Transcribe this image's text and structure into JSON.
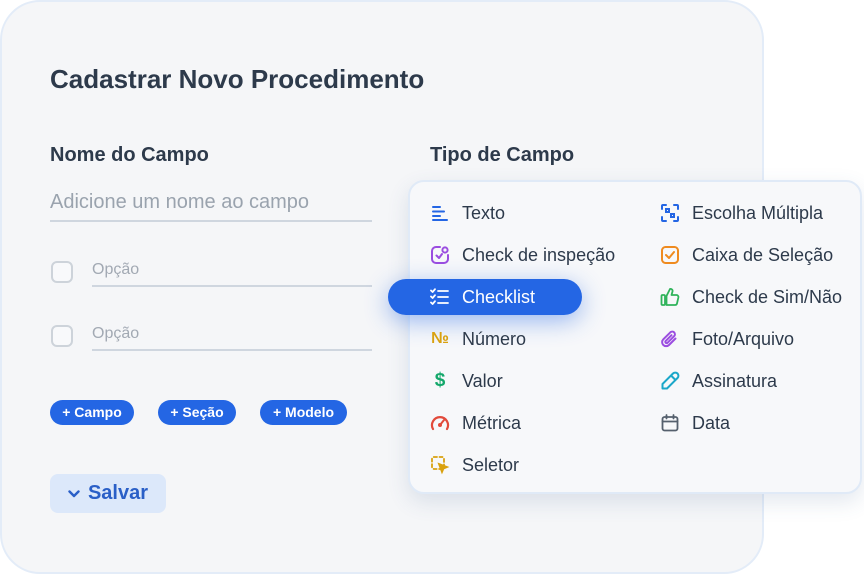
{
  "form": {
    "title": "Cadastrar Novo Procedimento",
    "field_name_label": "Nome do Campo",
    "field_name_placeholder": "Adicione um nome ao campo",
    "field_type_label": "Tipo de Campo",
    "options": [
      {
        "placeholder": "Opção",
        "checked": false
      },
      {
        "placeholder": "Opção",
        "checked": false
      }
    ],
    "add_buttons": [
      "+ Campo",
      "+ Seção",
      "+ Modelo"
    ],
    "save_label": "Salvar"
  },
  "field_types": {
    "selected": "Checklist",
    "left_column": [
      {
        "label": "Texto",
        "icon": "text-lines-icon",
        "color": "#2466e4"
      },
      {
        "label": "Check de inspeção",
        "icon": "check-inspection-icon",
        "color": "#9b4de0"
      },
      {
        "label": "Checklist",
        "icon": "checklist-icon",
        "color": "#ffffff"
      },
      {
        "label": "Número",
        "icon": "number-sign-icon",
        "color": "#d9a10f"
      },
      {
        "label": "Valor",
        "icon": "dollar-icon",
        "color": "#14a86b"
      },
      {
        "label": "Métrica",
        "icon": "gauge-icon",
        "color": "#e24a3b"
      },
      {
        "label": "Seletor",
        "icon": "selector-icon",
        "color": "#d9a10f"
      }
    ],
    "right_column": [
      {
        "label": "Escolha Múltipla",
        "icon": "multiple-choice-icon",
        "color": "#2466e4"
      },
      {
        "label": "Caixa de Seleção",
        "icon": "checkbox-icon",
        "color": "#ef8b1f"
      },
      {
        "label": "Check de Sim/Não",
        "icon": "thumbs-up-icon",
        "color": "#2fb35a"
      },
      {
        "label": "Foto/Arquivo",
        "icon": "paperclip-icon",
        "color": "#9b4de0"
      },
      {
        "label": "Assinatura",
        "icon": "pen-icon",
        "color": "#1ba7c9"
      },
      {
        "label": "Data",
        "icon": "calendar-icon",
        "color": "#55606d"
      }
    ]
  }
}
